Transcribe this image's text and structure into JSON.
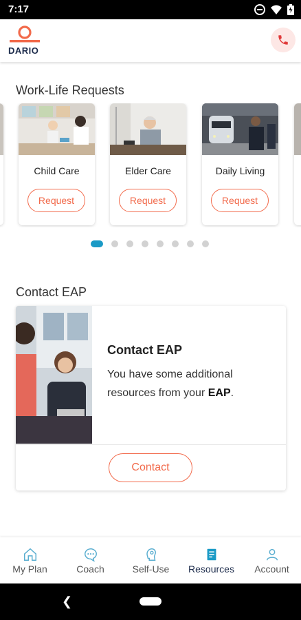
{
  "status_bar": {
    "time": "7:17"
  },
  "header": {
    "logo_text": "DARIO",
    "phone_icon": "phone-icon",
    "accent": "#f26a4b"
  },
  "work_life": {
    "title": "Work-Life Requests",
    "cards": [
      {
        "title": "Child Care",
        "button": "Request"
      },
      {
        "title": "Elder Care",
        "button": "Request"
      },
      {
        "title": "Daily Living",
        "button": "Request"
      }
    ],
    "pagination": {
      "total": 8,
      "active": 1
    }
  },
  "contact_eap": {
    "section_title": "Contact EAP",
    "heading": "Contact EAP",
    "body_prefix": "You have some additional resources from your ",
    "body_bold": "EAP",
    "body_suffix": ".",
    "button": "Contact"
  },
  "bottom_nav": {
    "items": [
      {
        "label": "My Plan",
        "icon": "home-icon"
      },
      {
        "label": "Coach",
        "icon": "chat-icon"
      },
      {
        "label": "Self-Use",
        "icon": "self-use-icon"
      },
      {
        "label": "Resources",
        "icon": "resources-icon",
        "active": true
      },
      {
        "label": "Account",
        "icon": "account-icon"
      }
    ],
    "active_color": "#1a9ac6",
    "inactive_color": "#5aaed0"
  }
}
